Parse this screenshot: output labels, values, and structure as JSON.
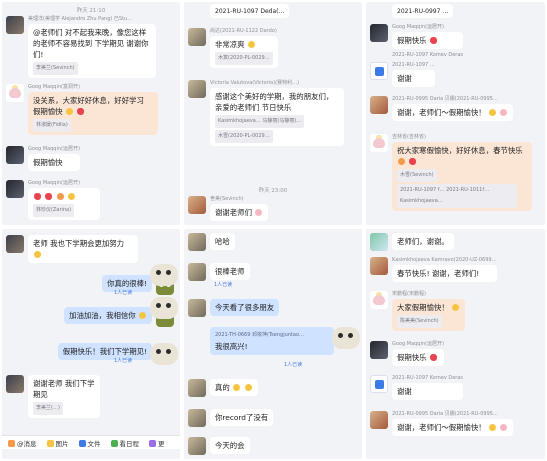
{
  "p1": {
    "time": "昨天 21:10",
    "m1": {
      "name": "美理洋(美理学 Alejandro Zhu Pang) 已Stu…",
      "text": "@老师们 对不起我来晚，像您这样的老师不容易找到 下学期见 谢谢你们!",
      "react": "李美兰(Sevinch)"
    },
    "m2": {
      "name": "Goog Maqqin(富洞开)",
      "text": "没关系，大家好好休息，好好学习 假期愉快",
      "react": "林淑媛(Fidila)"
    },
    "m3": {
      "name": "Goog Maqqin(运居开)",
      "text": "假期愉快"
    },
    "m4": {
      "name": "Goog Maqqin(运居开)",
      "text": "",
      "react": "林珍仪(Zarina)"
    }
  },
  "p2": {
    "m1": {
      "name": "",
      "text": "2021-RU-1097 Deda(…"
    },
    "m2": {
      "name": "尚达(2021-RU-1122 Dardo)",
      "text": "非常凉爽",
      "react": "木寅(2020-PL-0029…"
    },
    "m3": {
      "name": "Victoria Valutova(Victoria)(赛特利…)",
      "text": "感谢这个美好的学期，我的朋友们，亲爱的老师们 节日快乐",
      "react1": "Kasimkhojaeva… 马静丽(马静丽)…",
      "react2": "木雪(2020-PL-0029…"
    },
    "time": "昨天 23:00",
    "m4": {
      "name": "舍美(Sevinch)",
      "text": "谢谢老师们"
    }
  },
  "p3": {
    "m1": {
      "name": "",
      "text": "2021-RU-0997 …"
    },
    "m2": {
      "name": "Goog Maqqin(运居开)",
      "text": "假期快乐",
      "quote": "2021-RU-1097 Komev Deras"
    },
    "m3": {
      "name": "2021-RU-1097 …",
      "text": "谢谢"
    },
    "m4": {
      "name": "2021-RU-0995 Daria 贝娜(2021-RU-0995…",
      "text": "谢谢，老师们～假期愉快！"
    },
    "m5": {
      "name": "吉林省(吉林省)",
      "text": "祝大家寒假愉快，好好休息，春节快乐",
      "react1": "木雪(Sevinch)",
      "react2": "2021-RU-1097 f… 2021-RU-1011f… Kasimkhojaeva…"
    }
  },
  "p4": {
    "m1": {
      "name": "",
      "text": "老师 我也下学期会更加努力"
    },
    "r1": {
      "text": "你真的很棒!",
      "read": "1人已读"
    },
    "r2": {
      "text": "加油加油，我相信你",
      "read": ""
    },
    "r3": {
      "text": "假期快乐！我们下学期见!",
      "read": "1人已读"
    },
    "m2": {
      "name": "",
      "text": "谢谢老师 我们下学期见",
      "react": "李美兰(…)"
    },
    "tools": [
      "@消息",
      "图片",
      "文件",
      "看日程",
      "更"
    ]
  },
  "p5": {
    "m1": {
      "name": "",
      "text": "哈哈"
    },
    "m2": {
      "name": "",
      "text": "很棒老师",
      "read": "1人已读"
    },
    "r1": {
      "text": "今天看了很多朋友",
      "read": ""
    },
    "r2": {
      "quote": "2021-TH-0669 邓依萍(Tsengjuntao…",
      "text": "我很高兴!",
      "read": "1人已读"
    },
    "m3": {
      "name": "",
      "text": "真的"
    },
    "m4": {
      "name": "",
      "text": "你record了没有"
    },
    "m5": {
      "name": "",
      "text": "今天的会"
    }
  },
  "p6": {
    "m1": {
      "name": "",
      "text": "老师们，谢谢。"
    },
    "m2": {
      "name": "Kasimkhojaeva Kamravo(2020-UZ-0699…",
      "text": "春节快乐! 谢谢，老师们!"
    },
    "m3": {
      "name": "宋鹏程(宋鹏程)",
      "text": "大家假期愉快！",
      "react": "陈美美(Sevinch)"
    },
    "m4": {
      "name": "Goog Maqqin(运居开)",
      "text": "假期快乐"
    },
    "m5": {
      "name": "2021-RU-1097 Komev Deras",
      "text": "谢谢"
    },
    "m6": {
      "name": "2021-RU-0995 Daria 贝娜(2021-RU-0995…",
      "text": "谢谢，老师们～假期愉快！"
    }
  }
}
